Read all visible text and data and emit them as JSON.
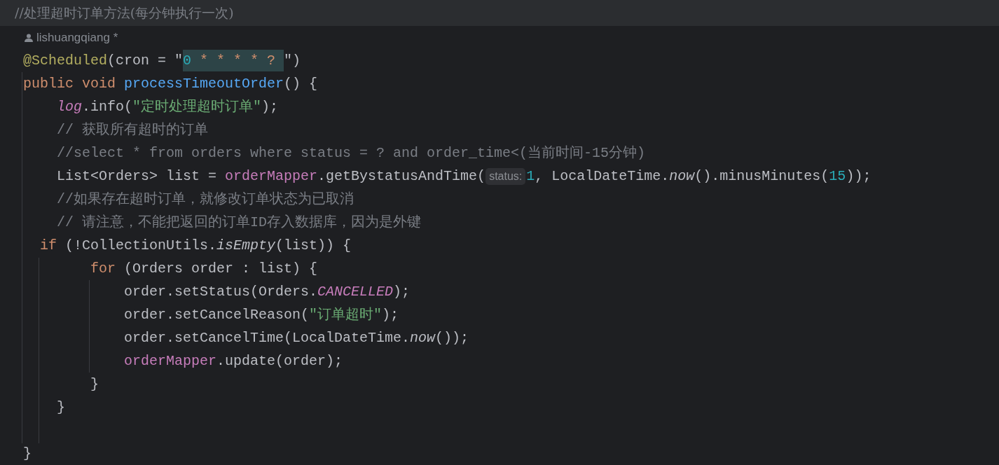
{
  "header_comment": "//处理超时订单方法(每分钟执行一次)",
  "author": "lishuangqiang *",
  "lines": [
    {
      "kind": "code",
      "tokens": [
        {
          "text": "@Scheduled",
          "kind": "annotation"
        },
        {
          "text": "(cron = \"",
          "kind": "plain"
        },
        {
          "text": "0",
          "kind": "number",
          "highlighted": true
        },
        {
          "text": " * * * * ? ",
          "kind": "cron",
          "highlighted": true
        },
        {
          "text": "\")",
          "kind": "plain"
        }
      ]
    },
    {
      "kind": "code",
      "tokens": [
        {
          "text": "public void ",
          "kind": "keyword"
        },
        {
          "text": "processTimeoutOrder",
          "kind": "method"
        },
        {
          "text": "() {",
          "kind": "plain"
        }
      ]
    },
    {
      "kind": "code",
      "tokens": [
        {
          "text": "    log",
          "kind": "static-field"
        },
        {
          "text": ".info(",
          "kind": "plain"
        },
        {
          "text": "\"定时处理超时订单\"",
          "kind": "string"
        },
        {
          "text": ");",
          "kind": "plain"
        }
      ]
    },
    {
      "kind": "code",
      "tokens": [
        {
          "text": "    // 获取所有超时的订单",
          "kind": "comment"
        }
      ]
    },
    {
      "kind": "code",
      "tokens": [
        {
          "text": "    //select * from orders where status = ? and order_time<(当前时间-15分钟)",
          "kind": "comment"
        }
      ]
    },
    {
      "kind": "code",
      "tokens": [
        {
          "text": "    List<Orders> list = ",
          "kind": "plain"
        },
        {
          "text": "orderMapper",
          "kind": "field"
        },
        {
          "text": ".getBystatusAndTime(",
          "kind": "plain"
        },
        {
          "text": "status:",
          "kind": "hint"
        },
        {
          "text": "1",
          "kind": "number"
        },
        {
          "text": ", LocalDateTime.",
          "kind": "plain"
        },
        {
          "text": "now",
          "kind": "static-call"
        },
        {
          "text": "().minusMinutes(",
          "kind": "plain"
        },
        {
          "text": "15",
          "kind": "number"
        },
        {
          "text": "));",
          "kind": "plain"
        }
      ]
    },
    {
      "kind": "code",
      "tokens": [
        {
          "text": "    //如果存在超时订单，就修改订单状态为已取消",
          "kind": "comment"
        }
      ]
    },
    {
      "kind": "code",
      "tokens": [
        {
          "text": "    // 请注意，不能把返回的订单ID存入数据库，因为是外键",
          "kind": "comment"
        }
      ]
    },
    {
      "kind": "code",
      "tokens": [
        {
          "text": "  if",
          "kind": "keyword"
        },
        {
          "text": " (!CollectionUtils.",
          "kind": "plain"
        },
        {
          "text": "isEmpty",
          "kind": "static-call"
        },
        {
          "text": "(list)) {",
          "kind": "plain"
        }
      ]
    },
    {
      "kind": "code",
      "tokens": [
        {
          "text": "        for",
          "kind": "keyword"
        },
        {
          "text": " (Orders order : list) {",
          "kind": "plain"
        }
      ]
    },
    {
      "kind": "code",
      "tokens": [
        {
          "text": "            order.setStatus(Orders.",
          "kind": "plain"
        },
        {
          "text": "CANCELLED",
          "kind": "constant"
        },
        {
          "text": ");",
          "kind": "plain"
        }
      ]
    },
    {
      "kind": "code",
      "tokens": [
        {
          "text": "            order.setCancelReason(",
          "kind": "plain"
        },
        {
          "text": "\"订单超时\"",
          "kind": "string"
        },
        {
          "text": ");",
          "kind": "plain"
        }
      ]
    },
    {
      "kind": "code",
      "tokens": [
        {
          "text": "            order.setCancelTime(LocalDateTime.",
          "kind": "plain"
        },
        {
          "text": "now",
          "kind": "static-call"
        },
        {
          "text": "());",
          "kind": "plain"
        }
      ]
    },
    {
      "kind": "code",
      "tokens": [
        {
          "text": "            orderMapper",
          "kind": "field"
        },
        {
          "text": ".update(order);",
          "kind": "plain"
        }
      ]
    },
    {
      "kind": "code",
      "tokens": [
        {
          "text": "        }",
          "kind": "plain"
        }
      ]
    },
    {
      "kind": "code",
      "tokens": [
        {
          "text": "    }",
          "kind": "plain"
        }
      ]
    },
    {
      "kind": "blank"
    },
    {
      "kind": "code",
      "tokens": [
        {
          "text": "}",
          "kind": "plain"
        }
      ]
    }
  ]
}
